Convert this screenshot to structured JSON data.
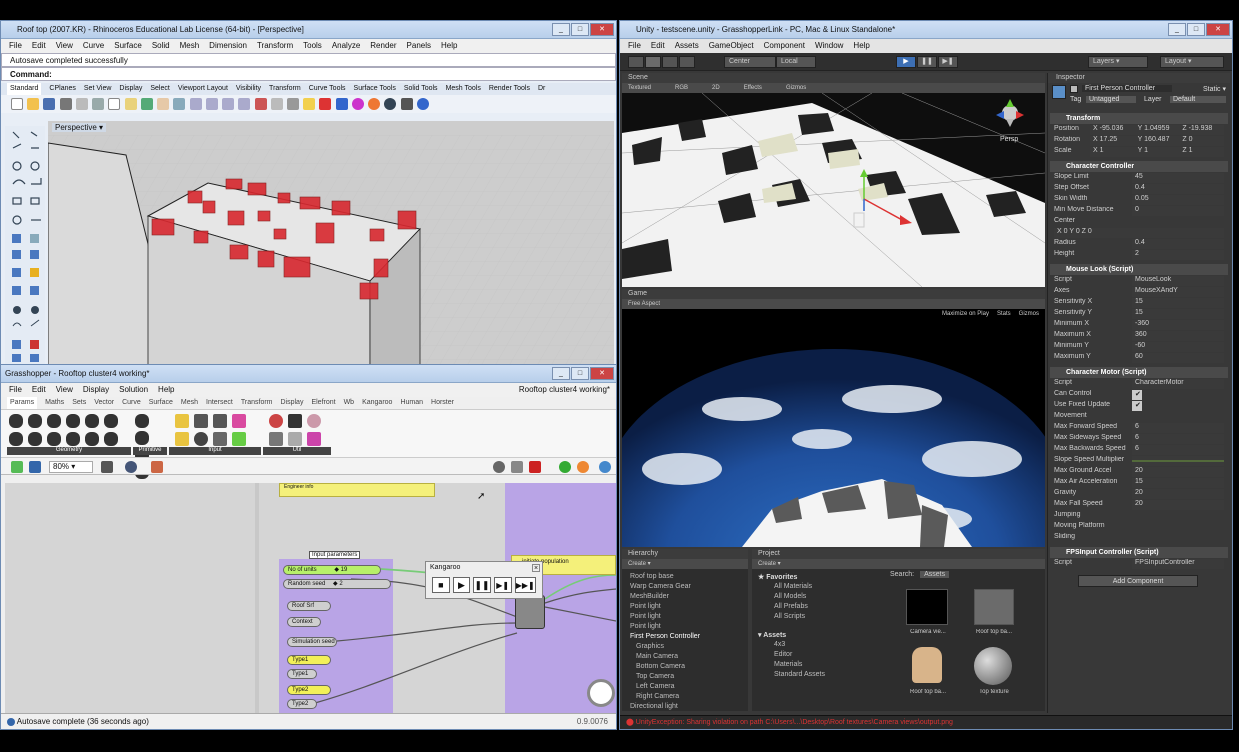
{
  "rhino": {
    "title": "Roof top (2007.KR) - Rhinoceros Educational Lab License (64-bit) - [Perspective]",
    "menu": [
      "File",
      "Edit",
      "View",
      "Curve",
      "Surface",
      "Solid",
      "Mesh",
      "Dimension",
      "Transform",
      "Tools",
      "Analyze",
      "Render",
      "Panels",
      "Help"
    ],
    "history": "Autosave completed successfully",
    "command_label": "Command:",
    "tabs": [
      "Standard",
      "CPlanes",
      "Set View",
      "Display",
      "Select",
      "Viewport Layout",
      "Visibility",
      "Transform",
      "Curve Tools",
      "Surface Tools",
      "Solid Tools",
      "Mesh Tools",
      "Render Tools",
      "Dr"
    ],
    "viewport_label": "Perspective"
  },
  "grasshopper": {
    "title": "Grasshopper - Rooftop cluster4 working*",
    "menu": [
      "File",
      "Edit",
      "View",
      "Display",
      "Solution",
      "Help"
    ],
    "doc_name": "Rooftop cluster4 working*",
    "tabs": [
      "Params",
      "Maths",
      "Sets",
      "Vector",
      "Curve",
      "Surface",
      "Mesh",
      "Intersect",
      "Transform",
      "Display",
      "Elefront",
      "Wb",
      "Kangaroo",
      "Human",
      "Horster"
    ],
    "groups": [
      "Geometry",
      "Primitive",
      "Input",
      "Util"
    ],
    "zoom": "80%",
    "status": "Autosave complete (36 seconds ago)",
    "version": "0.9.0076",
    "input_params_label": "Input parameters",
    "nodes": {
      "no_units": "No of units",
      "no_units_val": "◆ 19",
      "random_seed": "Random seed",
      "random_seed_val": "◆ 2",
      "roof_srf": "Roof Srf",
      "context": "Context",
      "sim_seed": "Simulation seed",
      "type1a": "Type1",
      "type1b": "Type1",
      "type2a": "Type2",
      "type2b": "Type2"
    },
    "kangaroo_title": "Kangaroo",
    "panel_text": "initiate population",
    "note_text": "Engineer info"
  },
  "unity": {
    "title": "Unity - testscene.unity - GrasshopperLink - PC, Mac & Linux Standalone*",
    "menu": [
      "File",
      "Edit",
      "Assets",
      "GameObject",
      "Component",
      "Window",
      "Help"
    ],
    "toolbar": {
      "center": "Center",
      "local": "Local",
      "layers": "Layers",
      "layout": "Layout"
    },
    "scene_tab": "Scene",
    "scene_bar": [
      "Textured",
      "RGB",
      "2D",
      "Effects",
      "Gizmos"
    ],
    "persp": "Persp",
    "game_tab": "Game",
    "game_bar_left": "Free Aspect",
    "game_bar_right": [
      "Maximize on Play",
      "Stats",
      "Gizmos"
    ],
    "inspector": {
      "tab": "Inspector",
      "object": "First Person Controller",
      "static": "Static",
      "tag_label": "Tag",
      "tag": "Untagged",
      "layer_label": "Layer",
      "layer": "Default",
      "transform": "Transform",
      "position": [
        "Position",
        "X -95.036",
        "Y 1.04959",
        "Z -19.938"
      ],
      "rotation": [
        "Rotation",
        "X 17.25",
        "Y 160.487",
        "Z 0"
      ],
      "scale": [
        "Scale",
        "X 1",
        "Y 1",
        "Z 1"
      ],
      "cc": "Character Controller",
      "cc_rows": [
        [
          "Slope Limit",
          "45"
        ],
        [
          "Step Offset",
          "0.4"
        ],
        [
          "Skin Width",
          "0.05"
        ],
        [
          "Min Move Distance",
          "0"
        ],
        [
          "Center",
          ""
        ],
        [
          "",
          "X 0     Y 0     Z 0"
        ],
        [
          "Radius",
          "0.4"
        ],
        [
          "Height",
          "2"
        ]
      ],
      "ml": "Mouse Look (Script)",
      "ml_rows": [
        [
          "Script",
          "MouseLook"
        ],
        [
          "Axes",
          "MouseXAndY"
        ],
        [
          "Sensitivity X",
          "15"
        ],
        [
          "Sensitivity Y",
          "15"
        ],
        [
          "Minimum X",
          "-360"
        ],
        [
          "Maximum X",
          "360"
        ],
        [
          "Minimum Y",
          "-60"
        ],
        [
          "Maximum Y",
          "60"
        ]
      ],
      "cm": "Character Motor (Script)",
      "cm_rows": [
        [
          "Script",
          "CharacterMotor"
        ],
        [
          "Can Control",
          "✔"
        ],
        [
          "Use Fixed Update",
          "✔"
        ],
        [
          "Movement",
          ""
        ],
        [
          "  Max Forward Speed",
          "6"
        ],
        [
          "  Max Sideways Speed",
          "6"
        ],
        [
          "  Max Backwards Speed",
          "6"
        ],
        [
          "  Slope Speed Multiplier",
          ""
        ],
        [
          "  Max Ground Accel",
          "20"
        ],
        [
          "  Max Air Acceleration",
          "15"
        ],
        [
          "  Gravity",
          "20"
        ],
        [
          "  Max Fall Speed",
          "20"
        ],
        [
          "Jumping",
          ""
        ],
        [
          "Moving Platform",
          ""
        ],
        [
          "Sliding",
          ""
        ]
      ],
      "fps": "FPSInput Controller (Script)",
      "fps_script": [
        "Script",
        "FPSInputController"
      ],
      "add_component": "Add Component"
    },
    "hierarchy": {
      "tab": "Hierarchy",
      "create": "Create",
      "items": [
        "Roof top base",
        "Warp Camera Gear",
        "MeshBuilder",
        "Point light",
        "Point light",
        "Point light",
        "First Person Controller",
        "  Graphics",
        "  Main Camera",
        "  Bottom Camera",
        "  Top Camera",
        "  Left Camera",
        "  Right Camera",
        "Directional light"
      ]
    },
    "project": {
      "tab": "Project",
      "create": "Create",
      "favorites": "Favorites",
      "fav_items": [
        "All Materials",
        "All Models",
        "All Prefabs",
        "All Scripts"
      ],
      "assets": "Assets",
      "asset_items": [
        "4x3",
        "Editor",
        "Materials",
        "Standard Assets"
      ],
      "search": "Search:",
      "search_scope": "Assets",
      "thumbs": [
        "Camera vie...",
        "Roof top ba...",
        "Roof top ba...",
        "Top texture"
      ]
    },
    "console_error": "UnityException: Sharing violation on path C:\\Users\\...\\Desktop\\Roof textures\\Camera views\\output.png"
  },
  "colors": {
    "unity_bg": "#383838",
    "gh_purple": "#b9a4e6",
    "gh_yellow": "#f4f07a",
    "rhino_red": "#d8282f",
    "sky": "#1f4f9c"
  }
}
